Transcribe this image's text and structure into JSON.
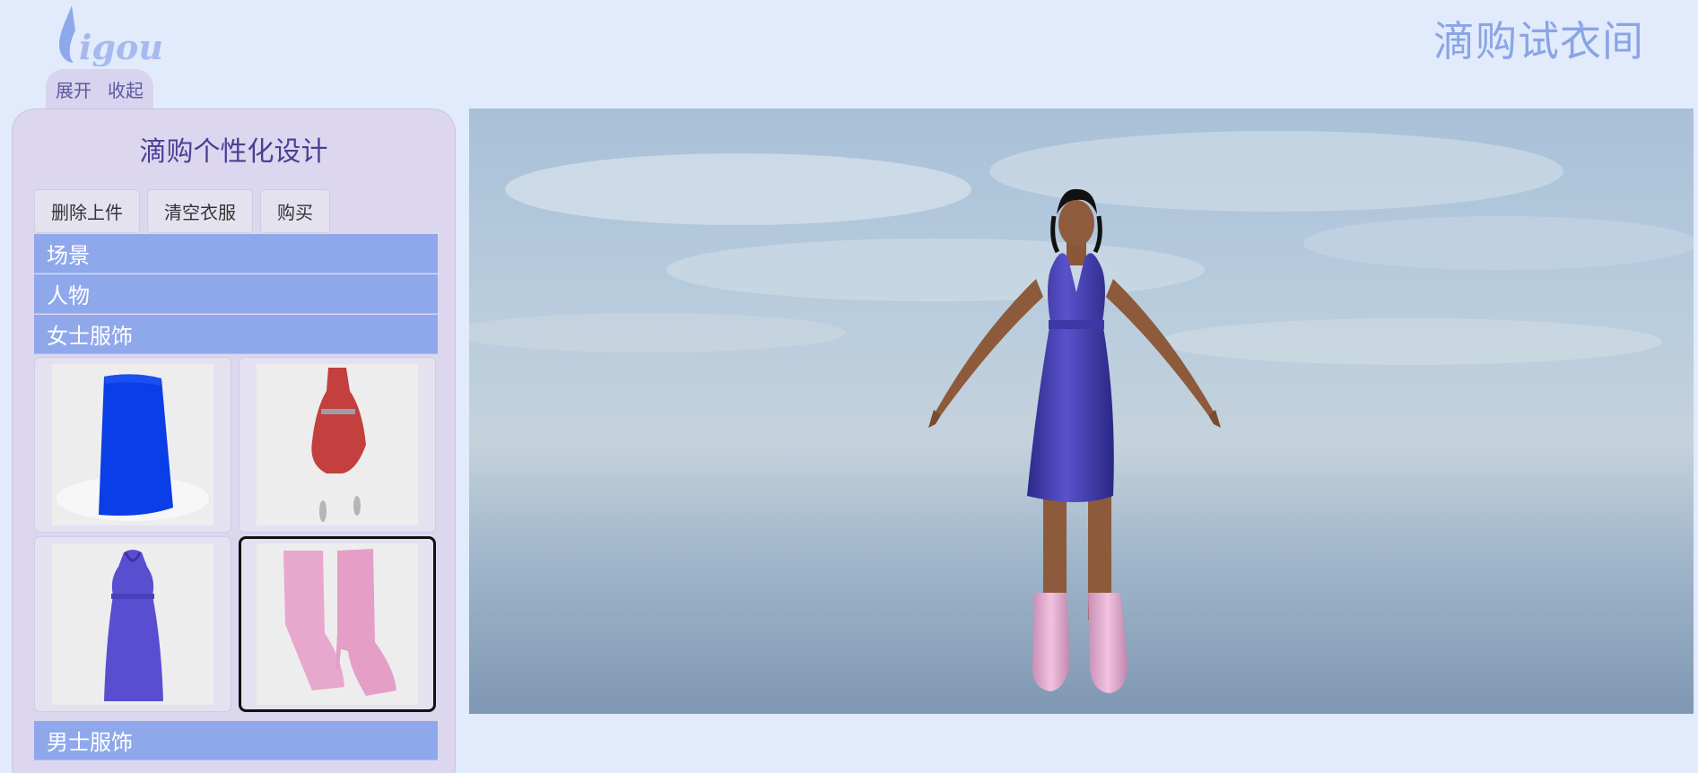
{
  "header": {
    "logo_text": "Digou",
    "site_title": "滴购试衣间",
    "expand_label": "展开",
    "collapse_label": "收起"
  },
  "sidebar": {
    "title": "滴购个性化设计",
    "buttons": {
      "delete_top": "删除上件",
      "clear_clothes": "清空衣服",
      "buy": "购买"
    },
    "categories": {
      "scene": "场景",
      "person": "人物",
      "women": "女士服饰",
      "men": "男士服饰"
    },
    "items": [
      {
        "name": "blue-skirt",
        "color": "#0a3ee6"
      },
      {
        "name": "red-dress",
        "color": "#c3403e"
      },
      {
        "name": "purple-halter-dress",
        "color": "#5a4ed0"
      },
      {
        "name": "pink-boots",
        "color": "#e8a7cc",
        "selected": true
      }
    ]
  },
  "viewport": {
    "scene": "sky-over-sea",
    "model": "female-avatar",
    "outfit_colors": {
      "dress": "#4a3fb8",
      "boots": "#e2a8cf",
      "skin": "#8d5a3c"
    }
  }
}
